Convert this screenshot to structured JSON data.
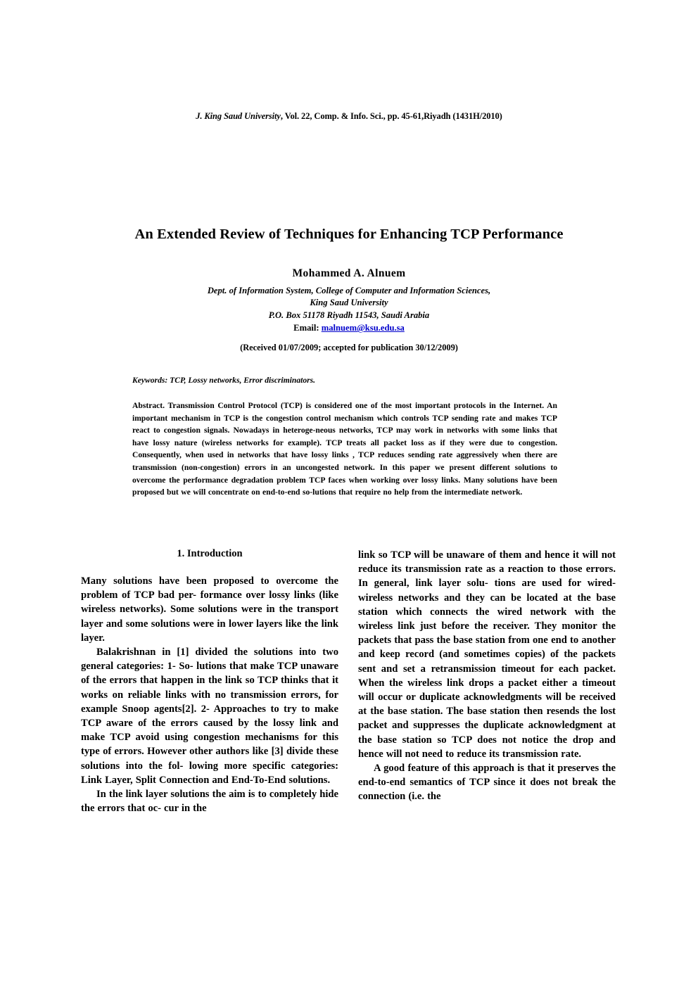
{
  "header": {
    "journal_italic_1": "J. King Saud University",
    "journal_rest": ", Vol. 22, Comp. & Info. Sci., pp. 45-61,Riyadh (1431H/2010)"
  },
  "title": "An Extended Review of Techniques for Enhancing TCP Performance",
  "author": {
    "name": "Mohammed  A.  Alnuem",
    "affiliation_line_1": "Dept. of Information System, College of Computer and Information Sciences,",
    "affiliation_line_2": "King Saud University",
    "affiliation_line_3": "P.O. Box 51178 Riyadh 11543, Saudi Arabia",
    "email_label": "Email:",
    "email": "malnuem@ksu.edu.sa"
  },
  "received": "(Received 01/07/2009; accepted for publication 30/12/2009)",
  "keywords": {
    "label": "Keywords:",
    "value": " TCP,  Lossy networks, Error discriminators."
  },
  "abstract": {
    "label": "Abstract.",
    "text": " Transmission  Control   Protocol   (TCP)  is  considered  one  of the  most  important protocols  in  the   Internet.  An  important  mechanism  in  TCP  is  the  congestion control  mechanism  which  controls   TCP  sending   rate   and   makes   TCP  react  to  congestion  signals.   Nowadays   in  heteroge-neous  networks, TCP  may  work  in  networks   with   some  links   that  have lossy  nature  (wireless  networks  for  example). TCP  treats  all packet  loss as  if they   were  due  to  congestion. Consequently,  when used  in  networks that have  lossy links ,  TCP reduces   sending   rate aggressively   when  there  are  transmission  (non-congestion)  errors  in  an  uncongested  network.  In this   paper    we  present  different  solutions   to  overcome   the   performance degradation  problem  TCP  faces  when   working  over  lossy  links.  Many solutions   have been   proposed  but   we  will concentrate  on  end-to-end so-lutions that require  no  help  from  the  intermediate  network."
  },
  "section": {
    "heading": "1.  Introduction"
  },
  "column_left": {
    "paragraphs": [
      "Many  solutions   have  been  proposed  to overcome  the  problem  of TCP  bad  per- formance over lossy links   (like  wireless  networks).    Some  solutions  were  in  the  transport  layer  and   some  solutions  were in lower layers like the  link layer.",
      "Balakrishnan  in [1] divided  the  solutions  into  two  general  categories:   1- So- lutions  that  make  TCP  unaware  of the  errors  that  happen  in  the  link so TCP thinks  that it works on reliable links  with  no  transmission errors,   for  example Snoop  agents[2].  2- Approaches  to  try   to  make  TCP  aware  of the  errors  caused by  the  lossy  link  and  make  TCP  avoid  using  congestion  mechanisms  for  this type of errors.  However  other  authors  like  [3] divide  these  solutions  into  the  fol- lowing more  specific  categories:   Link Layer,  Split  Connection  and  End-To-End solutions.",
      "In  the   link  layer  solutions    the    aim  is  to  completely  hide  the   errors   that  oc- cur   in  the"
    ]
  },
  "column_right": {
    "paragraphs": [
      "link so TCP  will be  unaware  of them  and  hence  it   will  not   reduce its  transmission  rate   as  a  reaction  to  those  errors.  In  general,  link  layer  solu- tions   are  used  for  wired-wireless  networks  and  they  can  be  located  at   the   base  station  which  connects    the    wired  network    with    the  wireless   link   just     before   the   receiver.    They  monitor   the   packets   that pass  the  base  station  from  one  end  to another   and   keep  record  (and  sometimes   copies)  of  the   packets   sent  and  set  a  retransmission  timeout  for  each  packet.   When  the  wireless  link  drops  a  packet either  a  timeout  will  occur  or  duplicate   acknowledgments   will  be  received  at  the  base  station. The base  station then  resends the lost packet and suppresses the duplicate  acknowledgment at  the  base  station  so TCP  does  not  notice  the  drop and  hence  will not  need  to  reduce its  transmission rate.",
      "A  good  feature   of  this  approach   is  that  it  preserves  the  end-to-end semantics  of TCP   since  it   does   not    break    the    connection    (i.e.   the"
    ]
  }
}
